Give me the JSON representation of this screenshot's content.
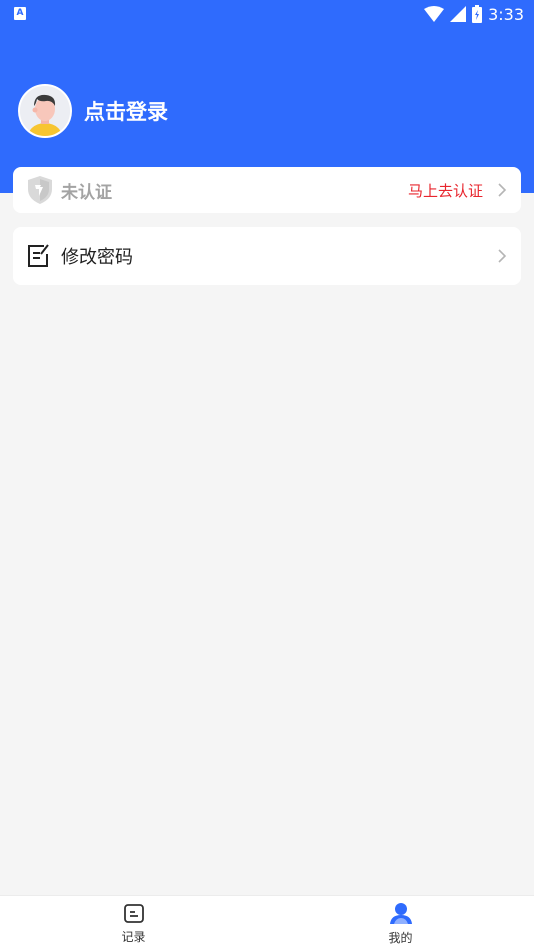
{
  "status_bar": {
    "indicator": "A",
    "time": "3:33",
    "icons": [
      "wifi-icon",
      "signal-icon",
      "battery-icon"
    ]
  },
  "header": {
    "login_label": "点击登录",
    "color": "#2f6bfd"
  },
  "certification": {
    "label": "未认证",
    "action": "马上去认证",
    "icon": "shield-v-icon",
    "action_color": "#e8262e"
  },
  "password": {
    "label": "修改密码",
    "icon": "edit-doc-icon"
  },
  "tabbar": {
    "tabs": [
      {
        "label": "记录",
        "icon": "record-icon",
        "active": false
      },
      {
        "label": "我的",
        "icon": "user-icon",
        "active": true
      }
    ]
  }
}
